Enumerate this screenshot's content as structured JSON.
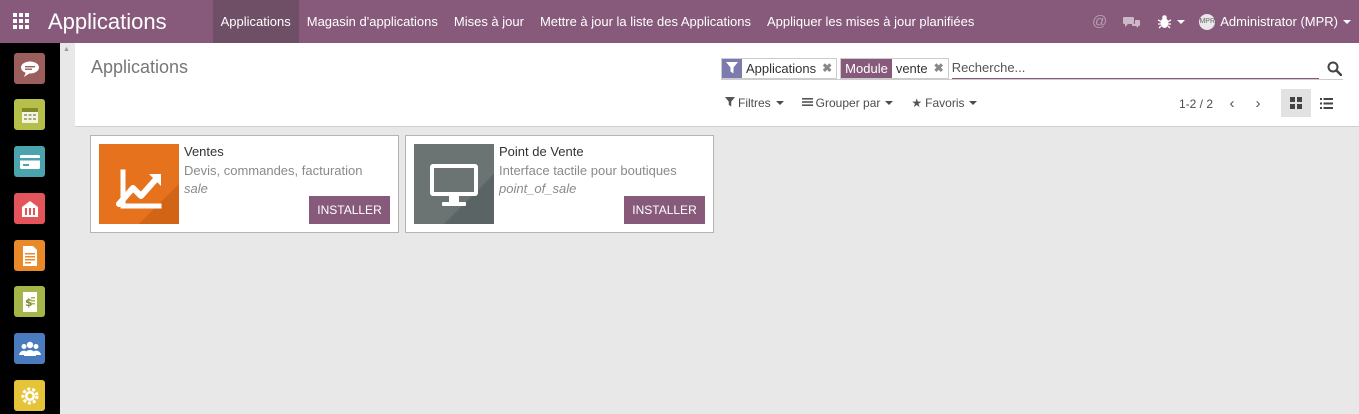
{
  "navbar": {
    "brand": "Applications",
    "menu": [
      {
        "label": "Applications",
        "active": true
      },
      {
        "label": "Magasin d'applications",
        "active": false
      },
      {
        "label": "Mises à jour",
        "active": false
      },
      {
        "label": "Mettre à jour la liste des Applications",
        "active": false
      },
      {
        "label": "Appliquer les mises à jour planifiées",
        "active": false
      }
    ],
    "icons": [
      "at-icon",
      "chat-icon",
      "bug-icon"
    ],
    "user": {
      "avatar_text": "MPR",
      "name": "Administrator (MPR)"
    }
  },
  "sidebar": {
    "apps": [
      {
        "icon": "discuss-icon",
        "color": "#9c5d5d"
      },
      {
        "icon": "calendar-icon",
        "color": "#b6bf4a"
      },
      {
        "icon": "card-icon",
        "color": "#4aa3ad"
      },
      {
        "icon": "warehouse-icon",
        "color": "#e3545b"
      },
      {
        "icon": "document-icon",
        "color": "#e88a2a"
      },
      {
        "icon": "invoice-icon",
        "color": "#a5b549"
      },
      {
        "icon": "users-icon",
        "color": "#4a7bbf"
      },
      {
        "icon": "gear-icon",
        "color": "#e6c43a"
      }
    ]
  },
  "control": {
    "title": "Applications",
    "facets": [
      {
        "label": "",
        "icon": "filter-icon",
        "value": "Applications"
      },
      {
        "label": "Module",
        "value": "vente"
      }
    ],
    "search_placeholder": "Recherche...",
    "filters_label": "Filtres",
    "groupby_label": "Grouper par",
    "favorites_label": "Favoris",
    "pager": "1-2 / 2",
    "views": [
      "kanban-view-icon",
      "list-view-icon"
    ]
  },
  "kanban": {
    "cards": [
      {
        "name": "Ventes",
        "summary": "Devis, commandes, facturation",
        "technical": "sale",
        "button": "INSTALLER",
        "icon": "sales-chart-icon",
        "color": "#e7721e"
      },
      {
        "name": "Point de Vente",
        "summary": "Interface tactile pour boutiques",
        "technical": "point_of_sale",
        "button": "INSTALLER",
        "icon": "monitor-icon",
        "color": "#6b7373"
      }
    ]
  }
}
